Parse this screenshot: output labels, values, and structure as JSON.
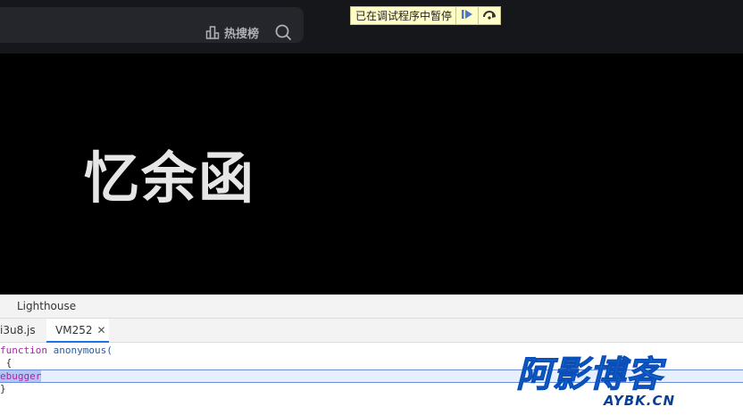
{
  "header": {
    "hot_label": "热搜榜",
    "hot_icon": "bar-chart-icon",
    "search_icon": "search-icon"
  },
  "debugger_overlay": {
    "text": "已在调试程序中暂停",
    "resume_icon": "resume-icon",
    "step_over_icon": "step-over-icon"
  },
  "hero": {
    "title": "忆余函"
  },
  "devtools": {
    "panel_tab": "Lighthouse",
    "file_tabs": [
      "i3u8.js",
      "VM252"
    ],
    "code_lines": [
      {
        "kw": "function",
        "rest": " anonymous("
      },
      {
        "kw": "",
        "rest": " {"
      },
      {
        "kw": "ebugger",
        "rest": ""
      },
      {
        "kw": "",
        "rest": "}"
      }
    ]
  },
  "watermark": {
    "main": "阿影博客",
    "sub": "AYBK.CN"
  },
  "colors": {
    "header_bg": "#16171a",
    "overlay_bg": "#fffec7",
    "accent_blue": "#1a73e8",
    "watermark_blue": "#1e6fe0"
  }
}
